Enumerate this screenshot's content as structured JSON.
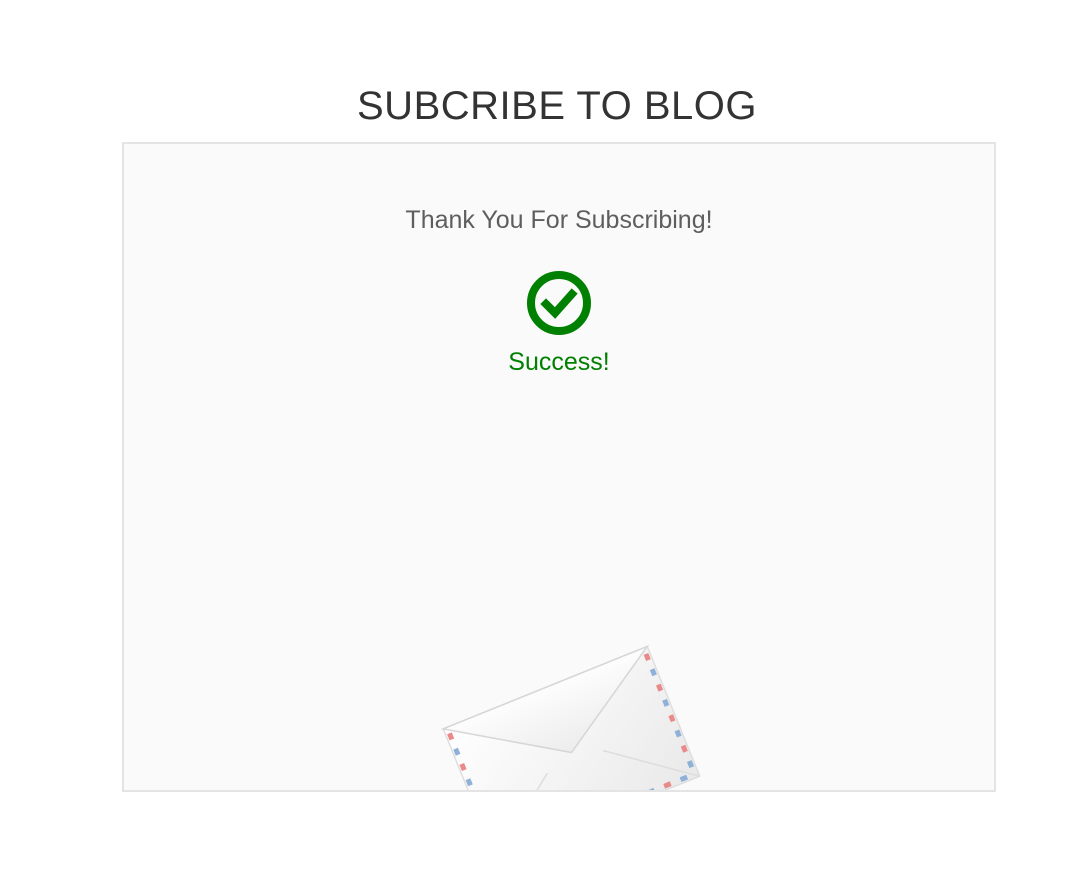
{
  "page": {
    "title": "SUBCRIBE TO BLOG"
  },
  "panel": {
    "message": "Thank You For Subscribing!",
    "status_icon": "check-circle-icon",
    "status_text": "Success!",
    "illustration_icon": "envelope-icon"
  },
  "colors": {
    "success": "#008000",
    "title": "#333333",
    "message": "#5e5e5e",
    "panel_bg": "#fafafa",
    "panel_border": "#e4e4e4",
    "airmail_red": "#e98a8a",
    "airmail_blue": "#8fb0d8"
  }
}
